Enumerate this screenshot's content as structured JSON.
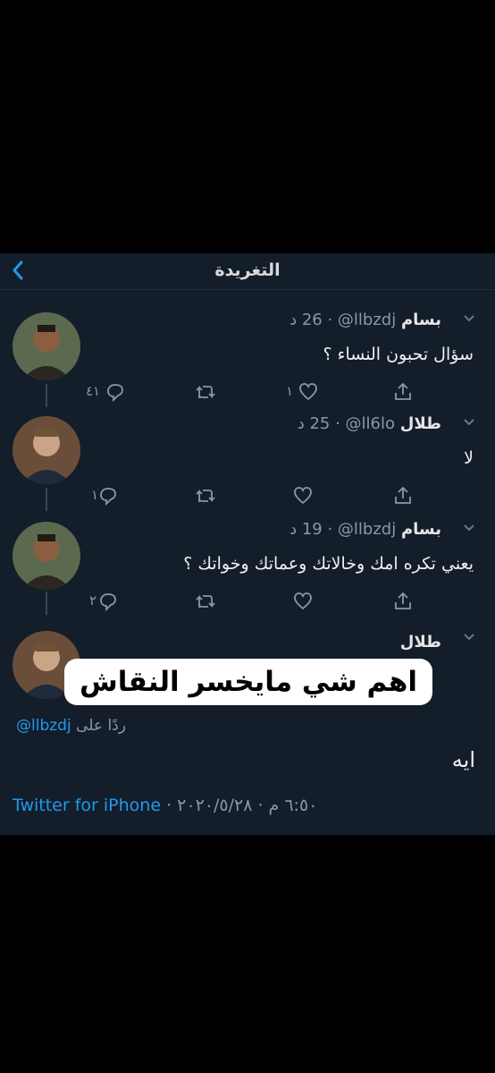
{
  "header": {
    "title": "التغريدة",
    "back_icon": "chevron-left-icon"
  },
  "tweets": [
    {
      "name": "بسام",
      "handle": "@llbzdj",
      "meta": "· 26 د",
      "text": "سؤال تحبون النساء ؟",
      "likes": "١",
      "replies": "٤١",
      "retweets": ""
    },
    {
      "name": "طلال",
      "handle": "@ll6lo",
      "meta": "· 25 د",
      "text": "لا",
      "likes": "",
      "replies": "١",
      "retweets": ""
    },
    {
      "name": "بسام",
      "handle": "@llbzdj",
      "meta": "· 19 د",
      "text": "يعني تكره امك وخالاتك وعماتك وخواتك ؟",
      "likes": "",
      "replies": "٢",
      "retweets": ""
    },
    {
      "name": "طلال",
      "handle": "",
      "meta": "",
      "text": ""
    }
  ],
  "overlay_caption": "اهم شي مايخسر النقاش",
  "reply_to": {
    "label": "ردًا على",
    "handle": "@llbzdj"
  },
  "main_text": "ايه",
  "footer": {
    "time_date": "٦:٥٠ م · ٢٠٢٠/٥/٢٨ ·",
    "source": "Twitter for iPhone"
  },
  "colors": {
    "background": "#141d2a",
    "accent": "#1d9bf0",
    "muted": "#8b98a5"
  }
}
